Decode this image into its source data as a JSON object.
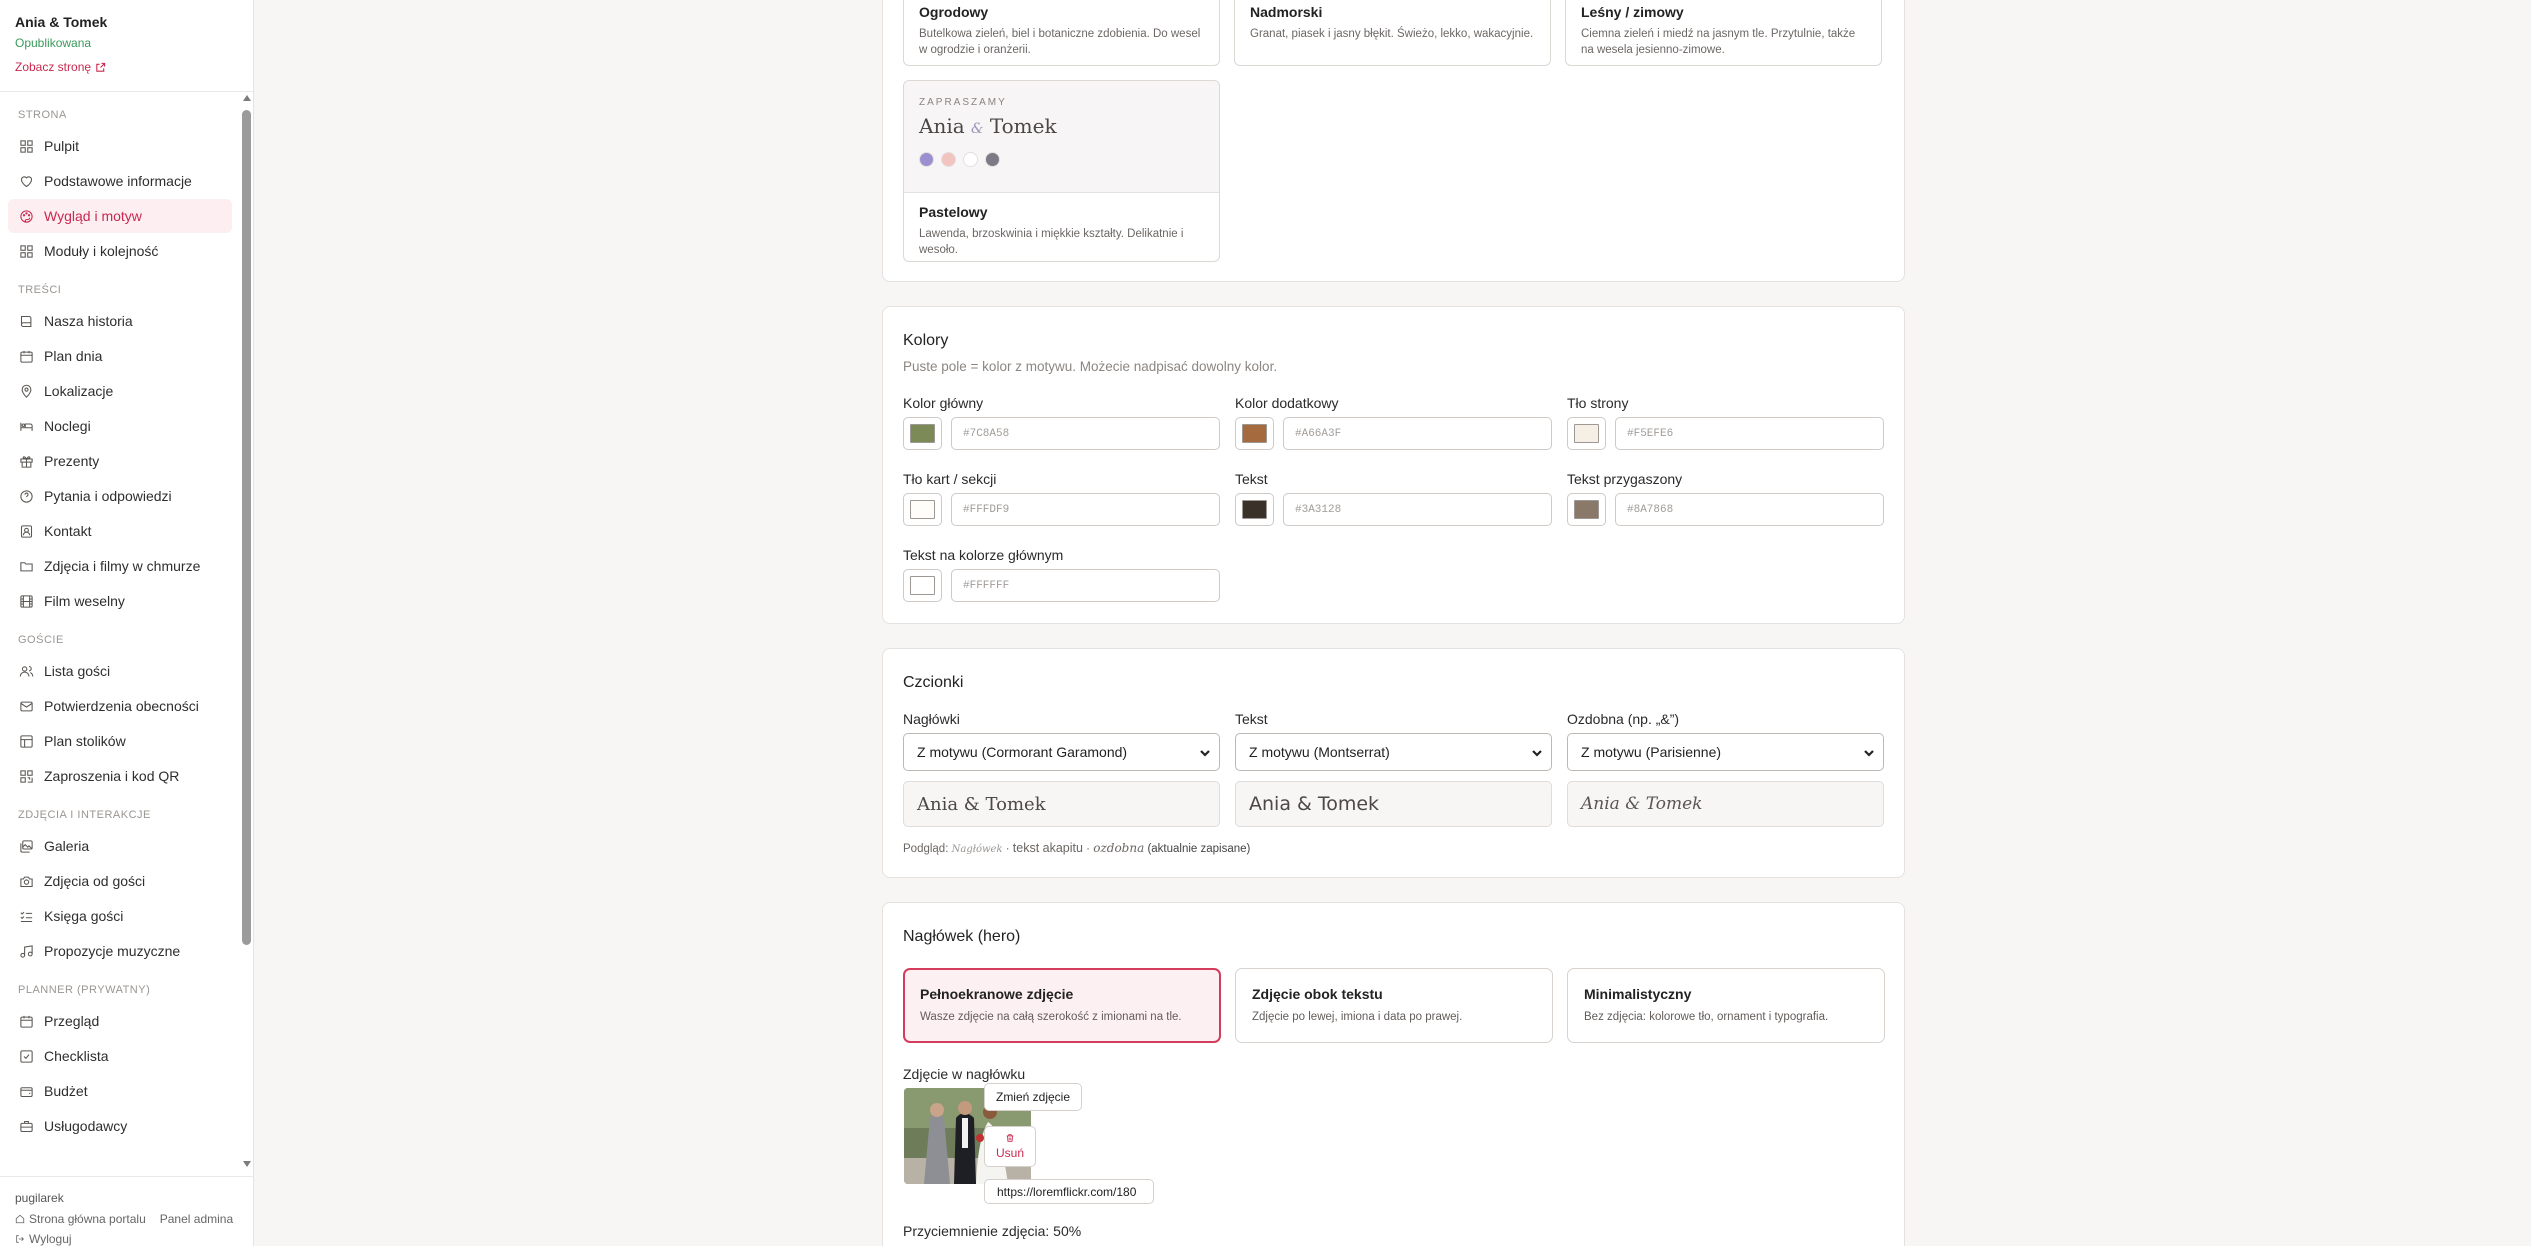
{
  "site": {
    "name": "Ania & Tomek",
    "status": "Opublikowana",
    "view_link": "Zobacz stronę"
  },
  "nav": {
    "sections": [
      {
        "label": "STRONA",
        "items": [
          {
            "label": "Pulpit",
            "icon": "grid-icon"
          },
          {
            "label": "Podstawowe informacje",
            "icon": "heart-icon"
          },
          {
            "label": "Wygląd i motyw",
            "icon": "palette-icon",
            "active": true
          },
          {
            "label": "Moduły i kolejność",
            "icon": "grid-icon"
          }
        ]
      },
      {
        "label": "TREŚCI",
        "items": [
          {
            "label": "Nasza historia",
            "icon": "book-icon"
          },
          {
            "label": "Plan dnia",
            "icon": "calendar-icon"
          },
          {
            "label": "Lokalizacje",
            "icon": "map-pin-icon"
          },
          {
            "label": "Noclegi",
            "icon": "bed-icon"
          },
          {
            "label": "Prezenty",
            "icon": "gift-icon"
          },
          {
            "label": "Pytania i odpowiedzi",
            "icon": "help-circle-icon"
          },
          {
            "label": "Kontakt",
            "icon": "contact-icon"
          },
          {
            "label": "Zdjęcia i filmy w chmurze",
            "icon": "folder-icon"
          },
          {
            "label": "Film weselny",
            "icon": "film-icon"
          }
        ]
      },
      {
        "label": "GOŚCIE",
        "items": [
          {
            "label": "Lista gości",
            "icon": "users-icon"
          },
          {
            "label": "Potwierdzenia obecności",
            "icon": "mail-icon"
          },
          {
            "label": "Plan stolików",
            "icon": "layout-icon"
          },
          {
            "label": "Zaproszenia i kod QR",
            "icon": "qr-icon"
          }
        ]
      },
      {
        "label": "ZDJĘCIA I INTERAKCJE",
        "items": [
          {
            "label": "Galeria",
            "icon": "images-icon"
          },
          {
            "label": "Zdjęcia od gości",
            "icon": "camera-icon"
          },
          {
            "label": "Księga gości",
            "icon": "list-check-icon"
          },
          {
            "label": "Propozycje muzyczne",
            "icon": "music-icon"
          }
        ]
      },
      {
        "label": "PLANNER (PRYWATNY)",
        "items": [
          {
            "label": "Przegląd",
            "icon": "calendar-icon"
          },
          {
            "label": "Checklista",
            "icon": "check-square-icon"
          },
          {
            "label": "Budżet",
            "icon": "wallet-icon"
          },
          {
            "label": "Usługodawcy",
            "icon": "briefcase-icon"
          }
        ]
      }
    ]
  },
  "footer": {
    "user": "pugilarek",
    "portal": "Strona główna portalu",
    "admin": "Panel admina",
    "logout": "Wyloguj"
  },
  "themes": {
    "top": [
      {
        "title": "Ogrodowy",
        "desc": "Butelkowa zieleń, biel i botaniczne zdobienia. Do wesel w ogrodzie i oranżerii."
      },
      {
        "title": "Nadmorski",
        "desc": "Granat, piasek i jasny błękit. Świeżo, lekko, wakacyjnie."
      },
      {
        "title": "Leśny / zimowy",
        "desc": "Ciemna zieleń i miedź na jasnym tle. Przytulnie, także na wesela jesienno-zimowe."
      }
    ],
    "pastel": {
      "kicker": "ZAPRASZAMY",
      "name1": "Ania",
      "amp": "&",
      "name2": "Tomek",
      "dots": [
        "#9b8fd0",
        "#f2c4c0",
        "#ffffff",
        "#7d7a86"
      ],
      "title": "Pastelowy",
      "desc": "Lawenda, brzoskwinia i miękkie kształty. Delikatnie i wesoło."
    }
  },
  "colors": {
    "title": "Kolory",
    "hint": "Puste pole = kolor z motywu. Możecie nadpisać dowolny kolor.",
    "fields": [
      {
        "label": "Kolor główny",
        "placeholder": "#7C8A58",
        "swatch": "#7c8a58"
      },
      {
        "label": "Kolor dodatkowy",
        "placeholder": "#A66A3F",
        "swatch": "#a66a3f"
      },
      {
        "label": "Tło strony",
        "placeholder": "#F5EFE6",
        "swatch": "#f5efe6"
      },
      {
        "label": "Tło kart / sekcji",
        "placeholder": "#FFFDF9",
        "swatch": "#fffdf9"
      },
      {
        "label": "Tekst",
        "placeholder": "#3A3128",
        "swatch": "#3a3128"
      },
      {
        "label": "Tekst przygaszony",
        "placeholder": "#8A7868",
        "swatch": "#8a7868"
      },
      {
        "label": "Tekst na kolorze głównym",
        "placeholder": "#FFFFFF",
        "swatch": "#ffffff"
      }
    ]
  },
  "fonts": {
    "title": "Czcionki",
    "fields": [
      {
        "label": "Nagłówki",
        "value": "Z motywu (Cormorant Garamond)",
        "preview": "Ania & Tomek"
      },
      {
        "label": "Tekst",
        "value": "Z motywu (Montserrat)",
        "preview": "Ania & Tomek"
      },
      {
        "label": "Ozdobna (np. „&”)",
        "value": "Z motywu (Parisienne)",
        "preview": "Ania & Tomek"
      }
    ],
    "preview_prefix": "Podgląd:",
    "preview_heading": "Nagłówek",
    "preview_sep1": "·",
    "preview_body": "tekst akapitu",
    "preview_sep2": "·",
    "preview_deco": "ozdobna",
    "preview_suffix": "(aktualnie zapisane)"
  },
  "hero": {
    "title": "Nagłówek (hero)",
    "options": [
      {
        "title": "Pełnoekranowe zdjęcie",
        "desc": "Wasze zdjęcie na całą szerokość z imionami na tle.",
        "selected": true
      },
      {
        "title": "Zdjęcie obok tekstu",
        "desc": "Zdjęcie po lewej, imiona i data po prawej."
      },
      {
        "title": "Minimalistyczny",
        "desc": "Bez zdjęcia: kolorowe tło, ornament i typografia."
      }
    ],
    "photo_label": "Zdjęcie w nagłówku",
    "change_btn": "Zmień zdjęcie",
    "remove_btn": "Usuń",
    "url_value": "https://loremflickr.com/180",
    "dim_label": "Przyciemnienie zdjęcia: 50%"
  }
}
